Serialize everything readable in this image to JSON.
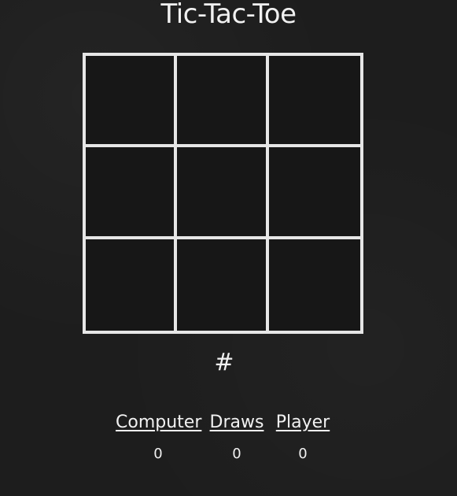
{
  "game": {
    "title": "Tic-Tac-Toe",
    "status_symbol": "#",
    "board": {
      "cells": [
        "",
        "",
        "",
        "",
        "",
        "",
        "",
        "",
        ""
      ]
    },
    "scores": {
      "computer_label": "Computer",
      "draws_label": "Draws",
      "player_label": "Player",
      "computer_value": "0",
      "draws_value": "0",
      "player_value": "0"
    }
  }
}
